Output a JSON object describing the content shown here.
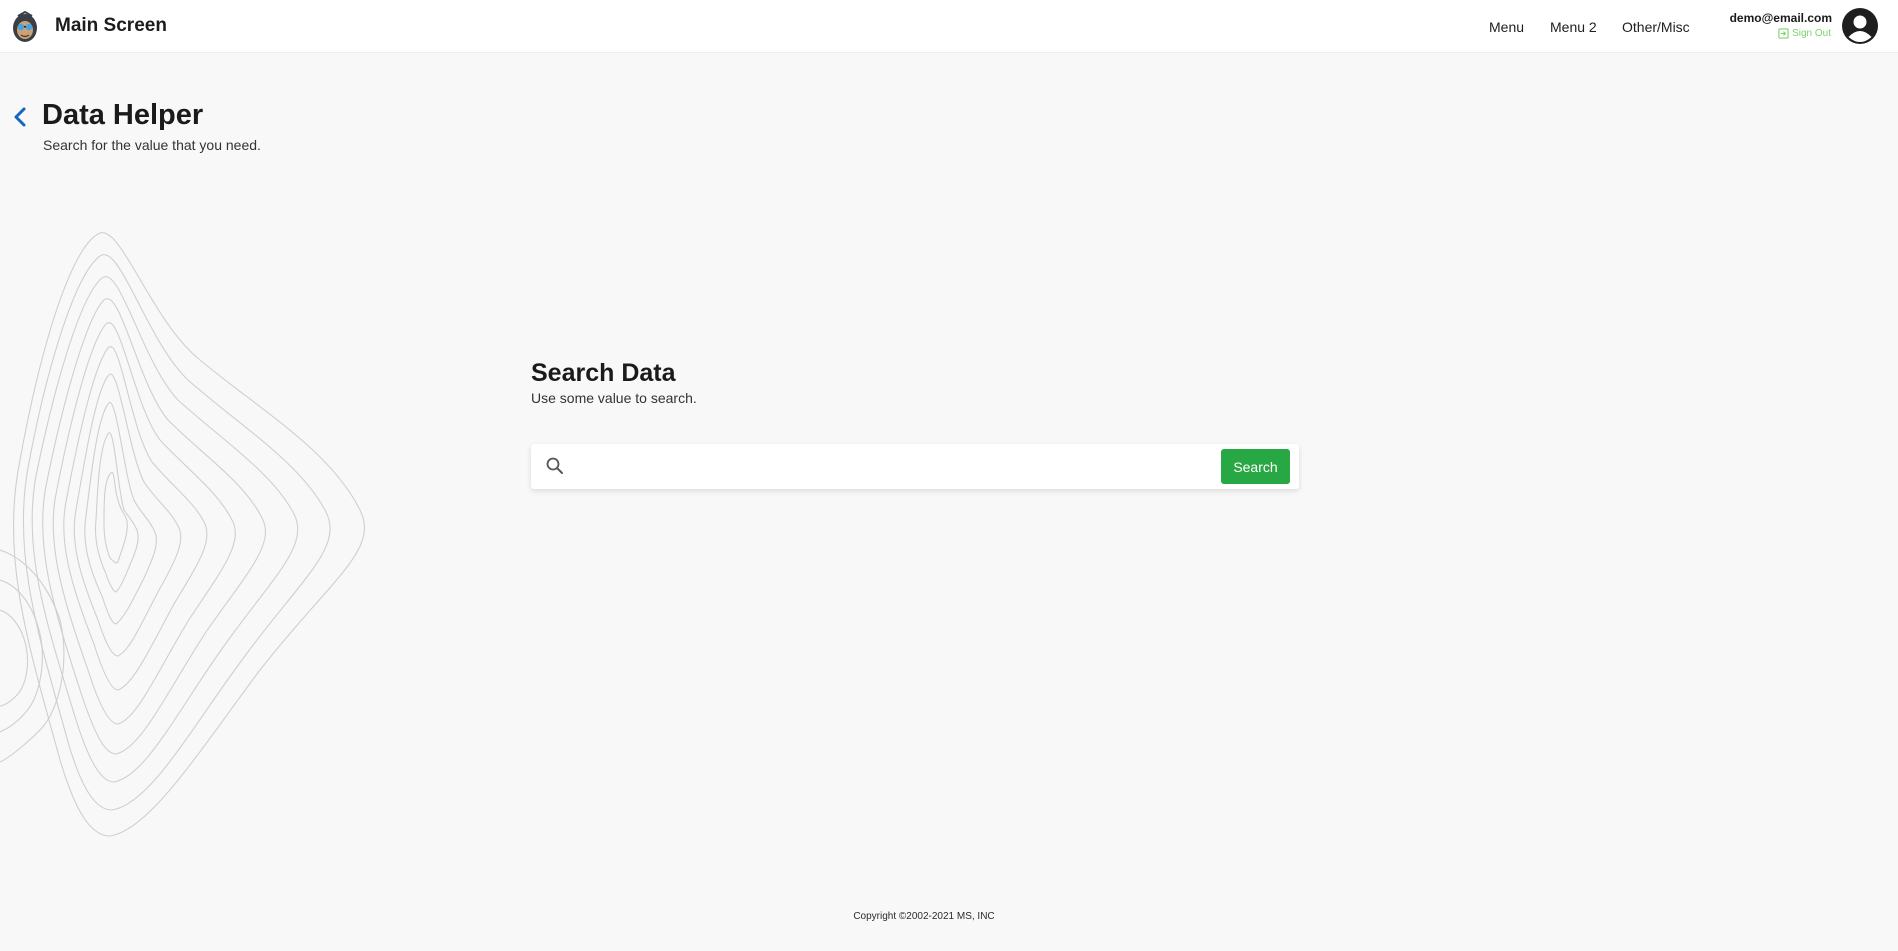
{
  "header": {
    "title": "Main Screen",
    "logo_icon": "monkey-mascot-icon",
    "nav": [
      {
        "label": "Menu"
      },
      {
        "label": "Menu 2"
      },
      {
        "label": "Other/Misc"
      }
    ],
    "user": {
      "email": "demo@email.com",
      "sign_out_label": "Sign Out",
      "sign_out_icon": "sign-out-icon",
      "avatar_icon": "user-avatar-icon"
    }
  },
  "page": {
    "title": "Data Helper",
    "subtitle": "Search for the value that you need.",
    "back_icon": "chevron-left-icon"
  },
  "search": {
    "title": "Search Data",
    "subtitle": "Use some value to search.",
    "input_value": "",
    "placeholder": "",
    "button_label": "Search",
    "icon": "search-icon"
  },
  "footer": {
    "copyright": "Copyright ©2002-2021 MS, INC"
  },
  "colors": {
    "accent_green": "#28a745",
    "sign_out_green": "#7bd36b",
    "back_icon_blue": "#1565c0",
    "background": "#f8f8f8"
  }
}
